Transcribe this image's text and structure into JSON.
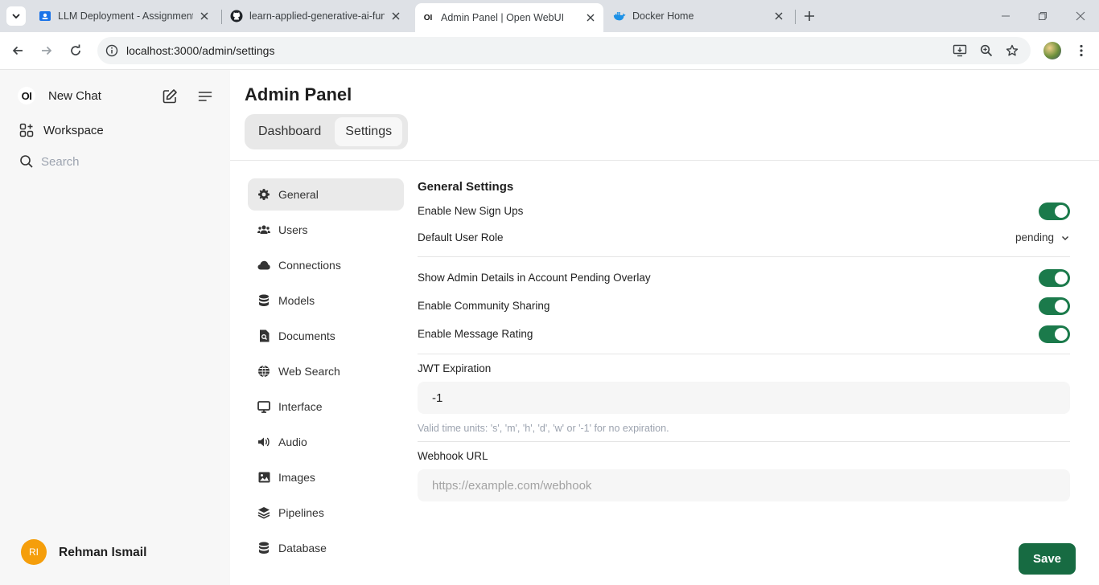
{
  "browser": {
    "tabs": [
      {
        "title": "LLM Deployment - Assignment",
        "icon": "google-classroom-icon"
      },
      {
        "title": "learn-applied-generative-ai-fun",
        "icon": "github-icon"
      },
      {
        "title": "Admin Panel | Open WebUI",
        "icon": "open-webui-icon",
        "favicon_text": "OI"
      },
      {
        "title": "Docker Home",
        "icon": "docker-icon"
      }
    ],
    "url": "localhost:3000/admin/settings"
  },
  "sidebar": {
    "logo_text": "OI",
    "new_chat": "New Chat",
    "workspace": "Workspace",
    "search_placeholder": "Search",
    "user": {
      "initials": "RI",
      "name": "Rehman Ismail",
      "avatar_color": "#f59e0b"
    }
  },
  "main": {
    "title": "Admin Panel",
    "tabs": [
      {
        "label": "Dashboard"
      },
      {
        "label": "Settings"
      }
    ],
    "settings_nav": [
      {
        "label": "General",
        "icon": "gear-icon"
      },
      {
        "label": "Users",
        "icon": "users-icon"
      },
      {
        "label": "Connections",
        "icon": "cloud-icon"
      },
      {
        "label": "Models",
        "icon": "database-icon"
      },
      {
        "label": "Documents",
        "icon": "document-search-icon"
      },
      {
        "label": "Web Search",
        "icon": "globe-icon"
      },
      {
        "label": "Interface",
        "icon": "monitor-icon"
      },
      {
        "label": "Audio",
        "icon": "speaker-icon"
      },
      {
        "label": "Images",
        "icon": "image-icon"
      },
      {
        "label": "Pipelines",
        "icon": "layers-icon"
      },
      {
        "label": "Database",
        "icon": "database-icon"
      }
    ],
    "general": {
      "title": "General Settings",
      "enable_signups": "Enable New Sign Ups",
      "default_role_label": "Default User Role",
      "default_role_value": "pending",
      "show_admin_details": "Show Admin Details in Account Pending Overlay",
      "community_sharing": "Enable Community Sharing",
      "message_rating": "Enable Message Rating",
      "jwt_label": "JWT Expiration",
      "jwt_value": "-1",
      "jwt_hint": "Valid time units: 's', 'm', 'h', 'd', 'w' or '-1' for no expiration.",
      "webhook_label": "Webhook URL",
      "webhook_placeholder": "https://example.com/webhook",
      "save_label": "Save"
    },
    "colors": {
      "accent": "#176b42",
      "toggle_on": "#1b7a4b"
    }
  }
}
